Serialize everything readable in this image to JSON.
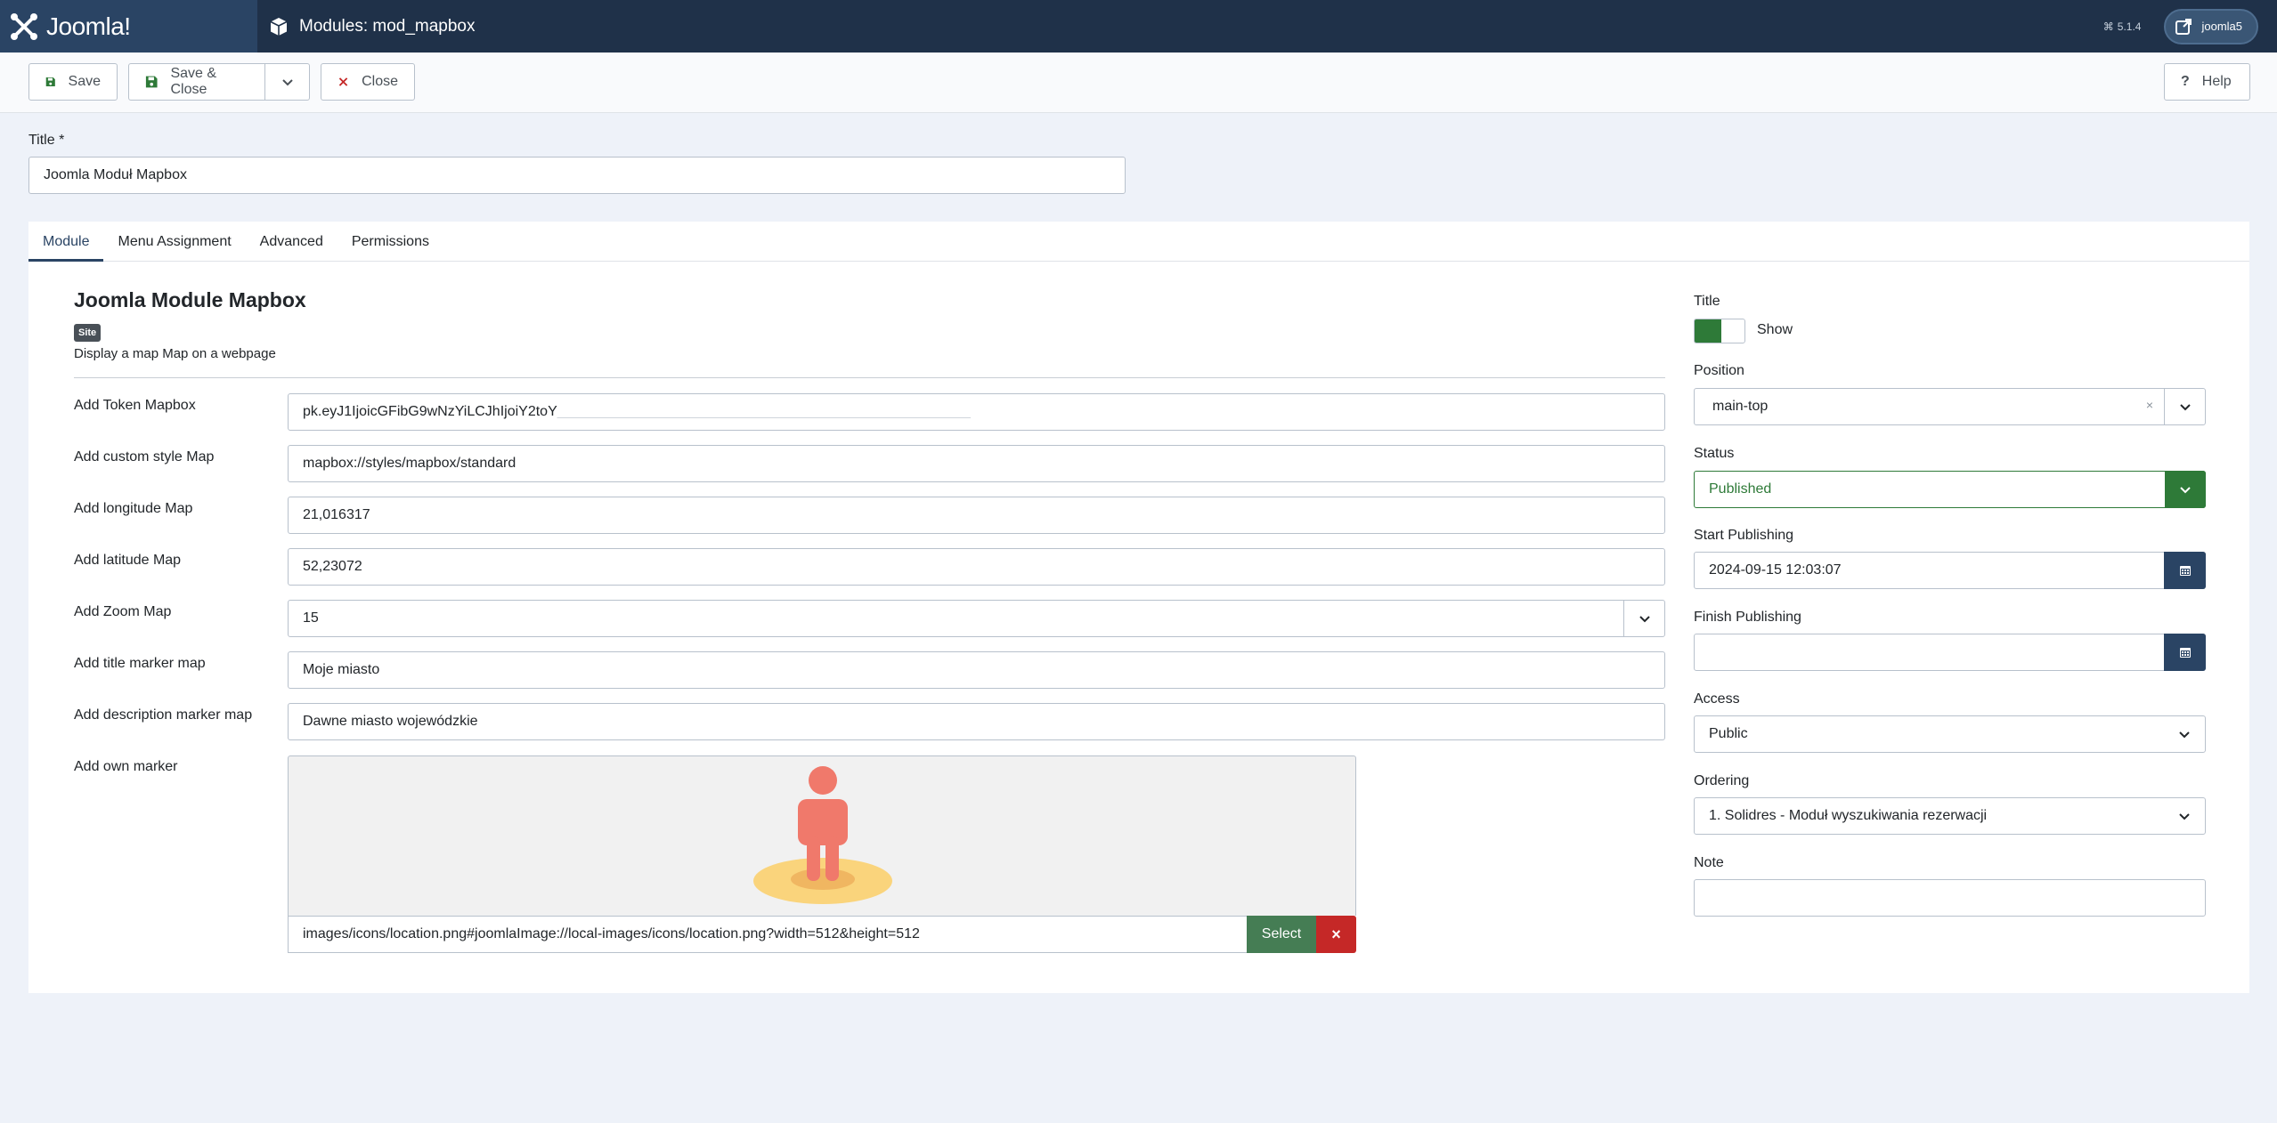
{
  "header": {
    "brand": "Joomla!",
    "page_title": "Modules: mod_mapbox",
    "version": "5.1.4",
    "site_button": "joomla5"
  },
  "toolbar": {
    "save_label": "Save",
    "save_close_label": "Save & Close",
    "close_label": "Close",
    "help_label": "Help"
  },
  "title_field": {
    "label": "Title *",
    "value": "Joomla Moduł Mapbox"
  },
  "tabs": [
    {
      "label": "Module",
      "active": true
    },
    {
      "label": "Menu Assignment",
      "active": false
    },
    {
      "label": "Advanced",
      "active": false
    },
    {
      "label": "Permissions",
      "active": false
    }
  ],
  "module": {
    "title": "Joomla Module Mapbox",
    "badge": "Site",
    "description": "Display a map Map on a webpage"
  },
  "fields": {
    "token": {
      "label": "Add Token Mapbox",
      "value": "pk.eyJ1IjoicGFibG9wNzYiLCJhIjoiY2toY"
    },
    "style": {
      "label": "Add custom style Map",
      "value": "mapbox://styles/mapbox/standard"
    },
    "longitude": {
      "label": "Add longitude Map",
      "value": "21,016317"
    },
    "latitude": {
      "label": "Add latitude Map",
      "value": "52,23072"
    },
    "zoom": {
      "label": "Add Zoom Map",
      "value": "15"
    },
    "marker_title": {
      "label": "Add title marker map",
      "value": "Moje miasto"
    },
    "marker_desc": {
      "label": "Add description marker map",
      "value": "Dawne miasto wojewódzkie"
    },
    "marker": {
      "label": "Add own marker",
      "path": "images/icons/location.png#joomlaImage://local-images/icons/location.png?width=512&height=512",
      "select_label": "Select",
      "clear_label": "×"
    }
  },
  "sidebar": {
    "title": {
      "label": "Title",
      "toggle_label": "Show"
    },
    "position": {
      "label": "Position",
      "value": "main-top",
      "clear": "×"
    },
    "status": {
      "label": "Status",
      "value": "Published"
    },
    "start_publishing": {
      "label": "Start Publishing",
      "value": "2024-09-15 12:03:07"
    },
    "finish_publishing": {
      "label": "Finish Publishing",
      "value": ""
    },
    "access": {
      "label": "Access",
      "value": "Public"
    },
    "ordering": {
      "label": "Ordering",
      "value": "1. Solidres - Moduł wyszukiwania rezerwacji"
    },
    "note": {
      "label": "Note",
      "value": ""
    }
  },
  "colors": {
    "header_bg": "#1f3149",
    "brand_bg": "#2a4464",
    "success": "#2e7a38",
    "danger": "#c52827",
    "marker_figure": "#f0796b",
    "marker_base": "#fad47c"
  }
}
